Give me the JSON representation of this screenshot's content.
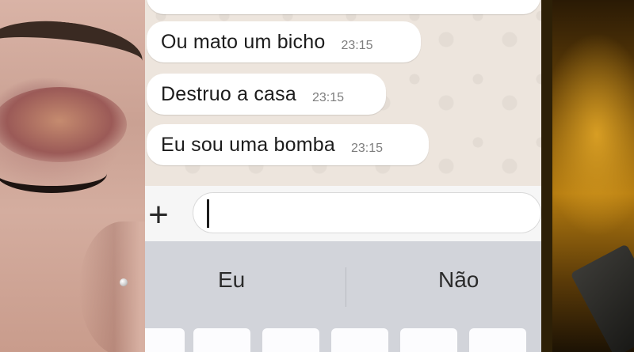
{
  "chat": {
    "messages": [
      {
        "text": "Ou mato um bicho",
        "time": "23:15"
      },
      {
        "text": "Destruo a casa",
        "time": "23:15"
      },
      {
        "text": "Eu sou uma bomba",
        "time": "23:15"
      }
    ],
    "composer": {
      "add_icon": "plus-icon",
      "input_value": ""
    }
  },
  "keyboard": {
    "suggestions": [
      "Eu",
      "Não"
    ]
  },
  "colors": {
    "chat_background": "#ede5dd",
    "bubble": "#ffffff",
    "keyboard": "#d2d4da"
  }
}
